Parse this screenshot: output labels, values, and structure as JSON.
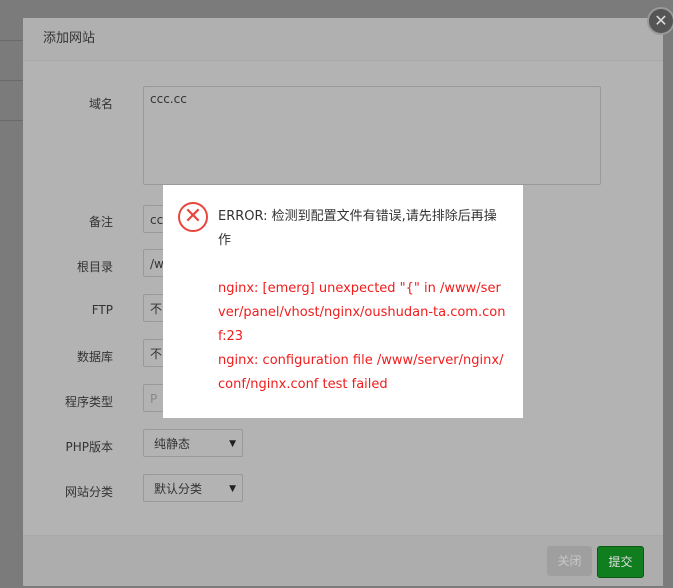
{
  "dialog": {
    "title": "添加网站",
    "close_icon": "close-icon",
    "fields": {
      "domain_label": "域名",
      "domain_value": "ccc.cc",
      "remark_label": "备注",
      "remark_value": "cc",
      "root_label": "根目录",
      "root_value": "/w",
      "ftp_label": "FTP",
      "ftp_value": "不",
      "db_label": "数据库",
      "db_value": "不",
      "type_label": "程序类型",
      "type_value": "P",
      "php_label": "PHP版本",
      "php_value": "纯静态",
      "category_label": "网站分类",
      "category_value": "默认分类"
    },
    "buttons": {
      "close": "关闭",
      "submit": "提交"
    }
  },
  "error": {
    "icon": "error-x-icon",
    "title": "ERROR: 检测到配置文件有错误,请先排除后再操作",
    "details": "nginx: [emerg] unexpected \"{\" in /www/server/panel/vhost/nginx/oushudan-ta.com.conf:23",
    "details2": "nginx: configuration file /www/server/nginx/conf/nginx.conf test failed"
  },
  "colors": {
    "submit": "#107d1e",
    "error": "#f01c1c"
  }
}
